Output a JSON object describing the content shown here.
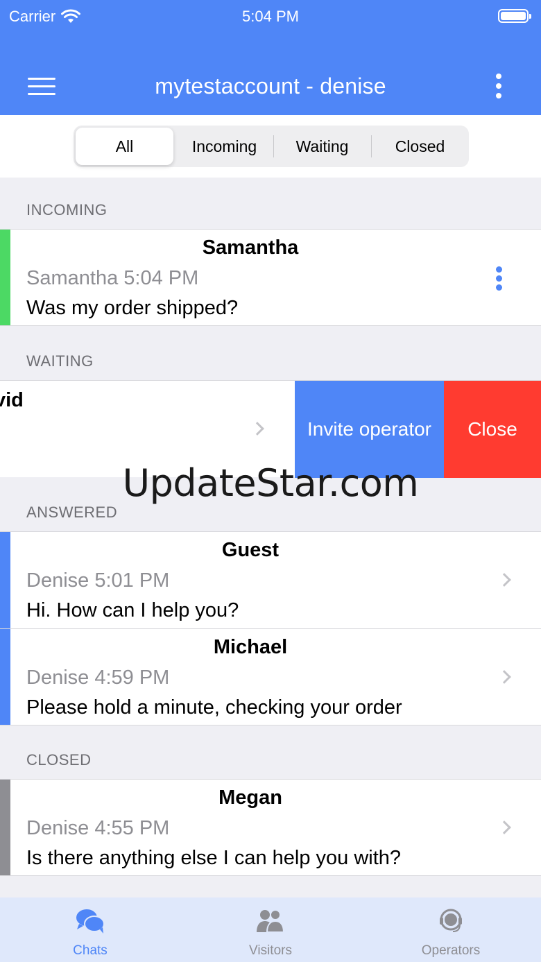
{
  "status_bar": {
    "carrier": "Carrier",
    "time": "5:04 PM"
  },
  "nav": {
    "title": "mytestaccount - denise"
  },
  "segments": [
    "All",
    "Incoming",
    "Waiting",
    "Closed"
  ],
  "selected_segment": "All",
  "sections": {
    "incoming": {
      "header": "INCOMING",
      "rows": [
        {
          "name": "Samantha",
          "meta": "Samantha 5:04 PM",
          "message": "Was my order shipped?",
          "accent": "#4cd964"
        }
      ]
    },
    "waiting": {
      "header": "WAITING",
      "swiped_row": {
        "name_fragment": "vid",
        "actions": {
          "invite": "Invite operator",
          "close": "Close"
        }
      }
    },
    "answered": {
      "header": "ANSWERED",
      "rows": [
        {
          "name": "Guest",
          "meta": "Denise 5:01 PM",
          "message": "Hi. How can I help you?",
          "accent": "#4f86f7"
        },
        {
          "name": "Michael",
          "meta": "Denise 4:59 PM",
          "message": "Please hold a minute, checking your order",
          "accent": "#4f86f7"
        }
      ]
    },
    "closed": {
      "header": "CLOSED",
      "rows": [
        {
          "name": "Megan",
          "meta": "Denise 4:55 PM",
          "message": "Is there anything else I can help you with?",
          "accent": "#8e8e93"
        }
      ]
    }
  },
  "watermark": "UpdateStar.com",
  "tabs": [
    {
      "label": "Chats",
      "icon": "chat-bubbles-icon",
      "active": true
    },
    {
      "label": "Visitors",
      "icon": "visitors-icon",
      "active": false
    },
    {
      "label": "Operators",
      "icon": "operator-headset-icon",
      "active": false
    }
  ],
  "colors": {
    "primary": "#4f86f7",
    "danger": "#ff3b30",
    "incoming": "#4cd964",
    "closed": "#8e8e93"
  }
}
